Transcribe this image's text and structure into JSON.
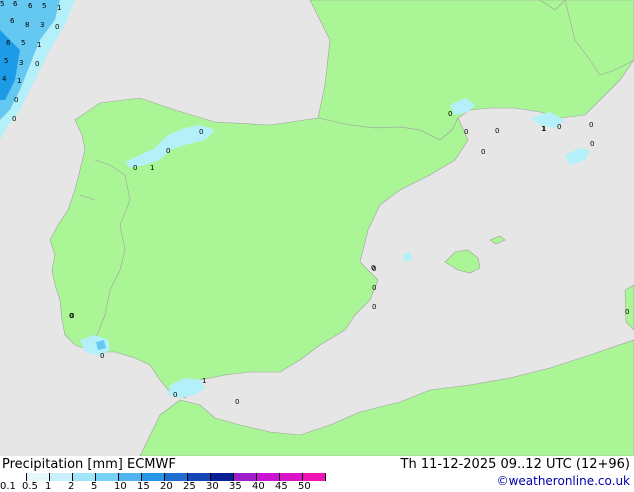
{
  "map": {
    "colors": {
      "sea": "#e6e6e6",
      "land": "#aaf596",
      "precip_light": "#b4f0fa",
      "precip_medium": "#64c8f0",
      "precip_heavy": "#1e9be6",
      "border": "#a0a0a0"
    },
    "precip_values": [
      "5",
      "6",
      "6",
      "5",
      "1",
      "6",
      "8",
      "3",
      "0",
      "6",
      "5",
      "1",
      "5",
      "3",
      "0",
      "4",
      "1",
      "0",
      "0",
      "0",
      "0",
      "1",
      "0",
      "0",
      "0",
      "0",
      "1",
      "0",
      "0",
      "0",
      "0",
      "0",
      "0",
      "0",
      "0",
      "0",
      "0",
      "1",
      "0",
      "0",
      "0",
      "1",
      "0"
    ]
  },
  "footer": {
    "title_left": "Precipitation [mm]  ECMWF",
    "title_right": "Th 11-12-2025 09..12 UTC (12+96)",
    "credit": "©weatheronline.co.uk"
  },
  "legend": {
    "labels": [
      "0.1",
      "0.5",
      "1",
      "2",
      "5",
      "10",
      "15",
      "20",
      "25",
      "30",
      "35",
      "40",
      "45",
      "50"
    ],
    "colors": [
      "#ffffff",
      "#e6f8fc",
      "#c8f0fa",
      "#a0e6f8",
      "#78d2f5",
      "#50b4f0",
      "#2896e6",
      "#1e6ed2",
      "#1446b4",
      "#0a1e96",
      "#a01ec8",
      "#c814d2",
      "#dc14c8",
      "#f014b4"
    ]
  }
}
